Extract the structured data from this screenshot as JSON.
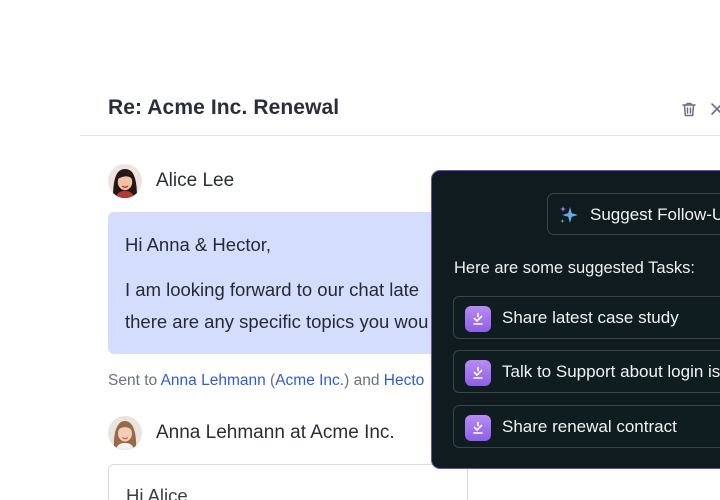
{
  "email": {
    "subject": "Re: Acme Inc. Renewal"
  },
  "messages": [
    {
      "sender": "Alice Lee",
      "body_lines": [
        "Hi Anna & Hector,",
        "I am looking forward to our chat late",
        "there are any specific topics you wou"
      ]
    },
    {
      "sender": "Anna Lehmann at Acme Inc.",
      "body_lines": [
        "Hi Alice,"
      ]
    }
  ],
  "sent_to": {
    "prefix": "Sent to ",
    "recipient1": "Anna Lehmann",
    "paren_open": " (",
    "company": "Acme Inc.",
    "paren_close": ")",
    "and": " and ",
    "recipient2": "Hecto"
  },
  "ai_panel": {
    "button_label": "Suggest Follow-U",
    "intro": "Here are some suggested Tasks:",
    "tasks": [
      "Share latest case study",
      "Talk to Support about login is",
      "Share renewal contract"
    ]
  },
  "colors": {
    "accent_purple": "#8e5fe6",
    "bubble_blue": "#d4ddfb",
    "link_blue": "#2f5bd8",
    "panel_bg": "#0f1b1e"
  },
  "icons": [
    "trash-icon",
    "close-icon",
    "sparkle-icon",
    "task-check-icon"
  ]
}
